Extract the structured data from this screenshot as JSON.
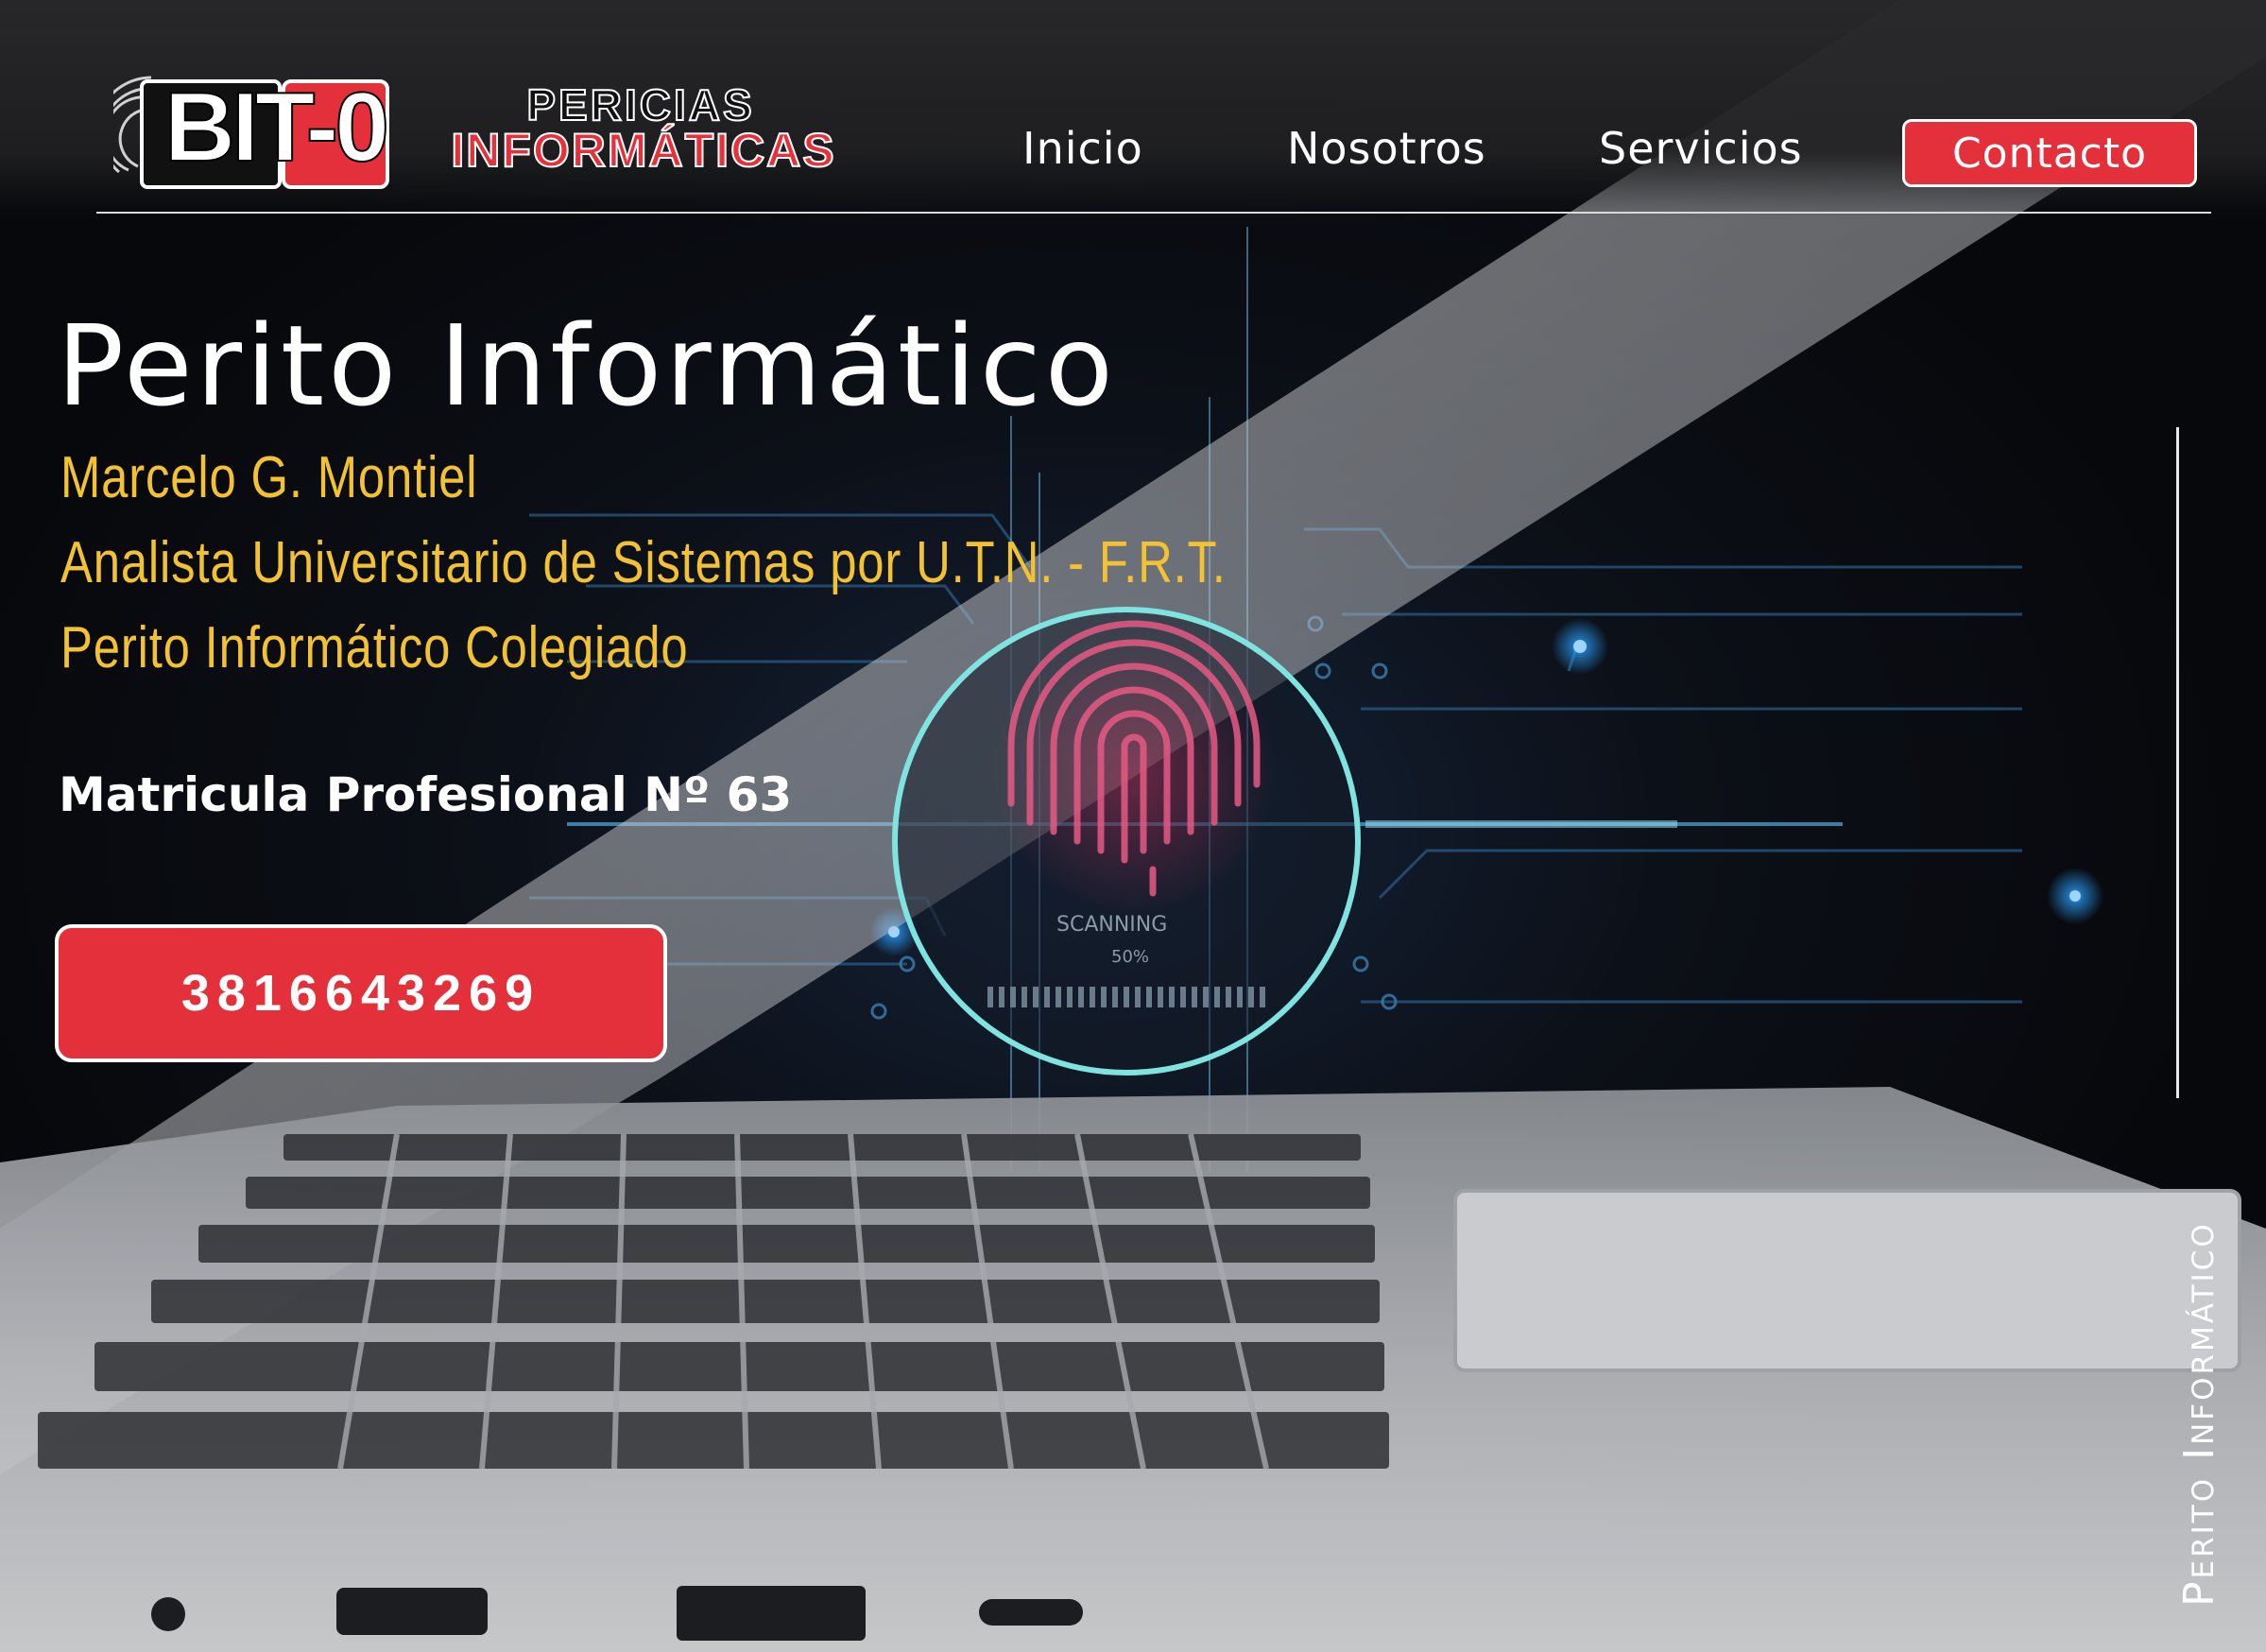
{
  "logo": {
    "mark": "BIT-0",
    "line1": "PERICIAS",
    "line2": "INFORMÁTICAS"
  },
  "nav": {
    "items": [
      "Inicio",
      "Nosotros",
      "Servicios"
    ],
    "contact_label": "Contacto"
  },
  "hero": {
    "title": "Perito Informático",
    "name": "Marcelo G. Montiel",
    "degree": "Analista Universitario de Sistemas por U.T.N. - F.R.T.",
    "role": "Perito Informático Colegiado",
    "license": "Matricula Profesional Nº 63",
    "phone": "3816643269"
  },
  "scanner": {
    "status": "SCANNING",
    "percent": "50%"
  },
  "side_label": "Perito Informático",
  "colors": {
    "accent_red": "#e3303b",
    "accent_yellow": "#f2c232",
    "background": "#0b0c10"
  }
}
